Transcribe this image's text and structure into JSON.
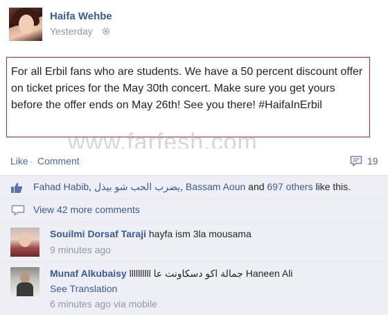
{
  "post": {
    "author": "Haifa Wehbe",
    "timestamp": "Yesterday",
    "text": "For all Erbil fans who are students. We have a 50 percent discount offer on ticket prices for the May 30th concert. Make sure you get yours before the offer ends on May 26th! See you there! #HaifaInErbil"
  },
  "watermark": "www.farfesh.com",
  "actions": {
    "like": "Like",
    "separator": "·",
    "comment": "Comment",
    "comment_count": "19"
  },
  "likes": {
    "user1": "Fahad Habib",
    "sep1": ", ",
    "user2": "يضرب الحب شو بيذل",
    "sep2": ", ",
    "user3": "Bassam Aoun",
    "and": " and ",
    "others": "697 others",
    "suffix": " like this."
  },
  "more_comments": "View 42 more comments",
  "comments": [
    {
      "author": "Souilmi Dorsaf Taraji",
      "text": "hayfa ism 3la mousama",
      "time": "9 minutes ago"
    },
    {
      "author": "Munaf Alkubaisy",
      "text": "llllllllll جمالة اكو دسكاونت عا",
      "mention": "Haneen Ali",
      "see_translation": "See Translation",
      "time": "6 minutes ago via mobile"
    }
  ],
  "colors": {
    "link": "#3b5998",
    "highlight_border": "#c81d2b",
    "ufi_background": "#edeff4"
  }
}
